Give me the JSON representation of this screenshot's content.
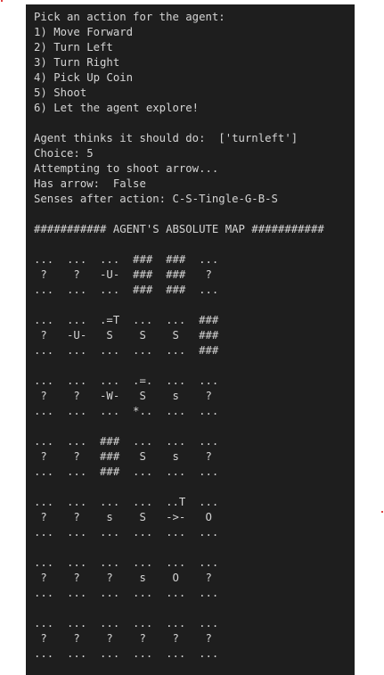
{
  "output_lines": [
    "Pick an action for the agent:",
    "1) Move Forward",
    "2) Turn Left",
    "3) Turn Right",
    "4) Pick Up Coin",
    "5) Shoot",
    "6) Let the agent explore!",
    "",
    "Agent thinks it should do:  ['turnleft']",
    "Choice: 5",
    "Attempting to shoot arrow...",
    "Has arrow:  False",
    "Senses after action: C-S-Tingle-G-B-S",
    "",
    "########### AGENT'S ABSOLUTE MAP ###########",
    "",
    "...  ...  ...  ###  ###  ...",
    " ?    ?   -U-  ###  ###   ?",
    "...  ...  ...  ###  ###  ...",
    "",
    "...  ...  .=T  ...  ...  ###",
    " ?   -U-   S    S    S   ###",
    "...  ...  ...  ...  ...  ###",
    "",
    "...  ...  ...  .=.  ...  ...",
    " ?    ?   -W-   S    s    ?",
    "...  ...  ...  *..  ...  ...",
    "",
    "...  ...  ###  ...  ...  ...",
    " ?    ?   ###   S    s    ?",
    "...  ...  ###  ...  ...  ...",
    "",
    "...  ...  ...  ...  ..T  ...",
    " ?    ?    s    S   ->-   O",
    "...  ...  ...  ...  ...  ...",
    "",
    "...  ...  ...  ...  ...  ...",
    " ?    ?    ?    s    O    ?",
    "...  ...  ...  ...  ...  ...",
    "",
    "...  ...  ...  ...  ...  ...",
    " ?    ?    ?    ?    ?    ?",
    "...  ...  ...  ...  ...  ..."
  ]
}
